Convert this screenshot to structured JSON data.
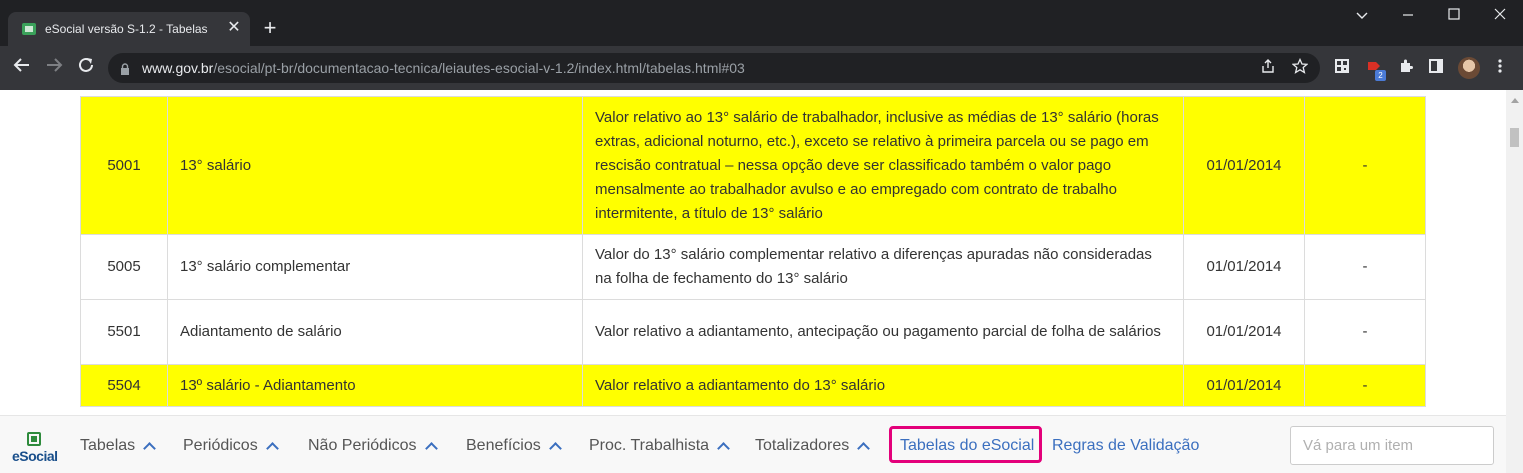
{
  "browser": {
    "tab_title": "eSocial versão S-1.2 - Tabelas",
    "url_host": "www.gov.br",
    "url_path": "/esocial/pt-br/documentacao-tecnica/leiautes-esocial-v-1.2/index.html/tabelas.html#03",
    "extension_badge": "2",
    "new_tab_glyph": "+",
    "close_glyph": "✕"
  },
  "table": {
    "rows": [
      {
        "code": "5001",
        "name": "13° salário",
        "description": "Valor relativo ao 13° salário de trabalhador, inclusive as médias de 13° salário (horas extras, adicional noturno, etc.), exceto se relativo à primeira parcela ou se pago em rescisão contratual – nessa opção deve ser classificado também o valor pago mensalmente ao trabalhador avulso e ao empregado com contrato de trabalho intermitente, a título de 13° salário",
        "start": "01/01/2014",
        "end": "-",
        "highlighted": true
      },
      {
        "code": "5005",
        "name": "13° salário complementar",
        "description": "Valor do 13° salário complementar relativo a diferenças apuradas não consideradas na folha de fechamento do 13° salário",
        "start": "01/01/2014",
        "end": "-",
        "highlighted": false
      },
      {
        "code": "5501",
        "name": "Adiantamento de salário",
        "description": "Valor relativo a adiantamento, antecipação ou pagamento parcial de folha de salários",
        "start": "01/01/2014",
        "end": "-",
        "highlighted": false
      },
      {
        "code": "5504",
        "name": "13º salário - Adiantamento",
        "description": "Valor relativo a adiantamento do 13° salário",
        "start": "01/01/2014",
        "end": "-",
        "highlighted": true
      }
    ],
    "highlight_color": "#ffff00"
  },
  "bottom_nav": {
    "logo_text": "eSocial",
    "items": [
      {
        "label": "Tabelas"
      },
      {
        "label": "Periódicos"
      },
      {
        "label": "Não Periódicos"
      },
      {
        "label": "Benefícios"
      },
      {
        "label": "Proc. Trabalhista"
      },
      {
        "label": "Totalizadores"
      }
    ],
    "active_link": "Tabelas do eSocial",
    "link_validation": "Regras de Validação",
    "goto_placeholder": "Vá para um item",
    "accent_color": "#e3007a",
    "link_color": "#3b6fbf"
  }
}
